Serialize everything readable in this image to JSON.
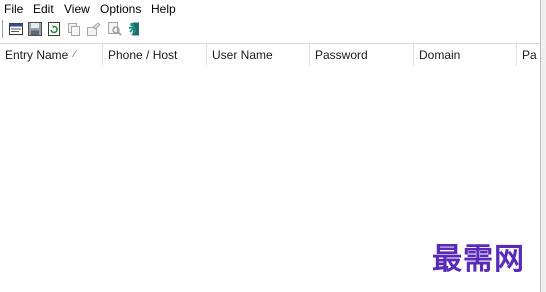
{
  "menu": {
    "file": "File",
    "edit": "Edit",
    "view": "View",
    "options": "Options",
    "help": "Help"
  },
  "toolbar": {
    "buttons": [
      "properties-icon",
      "save-icon",
      "refresh-icon",
      "copy-icon",
      "export-icon",
      "find-icon",
      "exit-icon"
    ]
  },
  "columns": [
    "Entry Name",
    "Phone / Host",
    "User Name",
    "Password",
    "Domain",
    "Pa"
  ],
  "sort_indicator": "⁄",
  "rows": [],
  "watermark": "最需网"
}
